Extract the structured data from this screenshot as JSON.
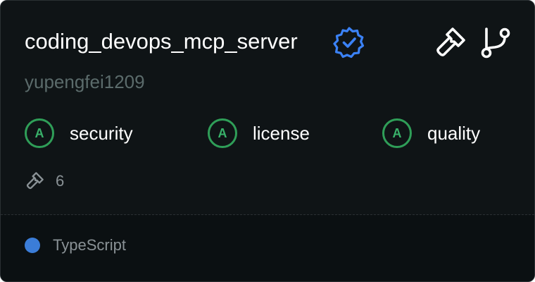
{
  "server": {
    "name": "coding_devops_mcp_server",
    "owner": "yupengfei1209"
  },
  "icons": {
    "verified": "verified-badge-icon",
    "tools": "hammer-icon",
    "fork": "git-fork-icon"
  },
  "scores": [
    {
      "grade": "A",
      "label": "security"
    },
    {
      "grade": "A",
      "label": "license"
    },
    {
      "grade": "A",
      "label": "quality"
    }
  ],
  "tools": {
    "count": "6"
  },
  "language": {
    "name": "TypeScript",
    "color": "#3b7dd8"
  },
  "colors": {
    "background": "#0f1416",
    "grade_green": "#2f9e58",
    "verified_blue": "#3b82f6"
  }
}
